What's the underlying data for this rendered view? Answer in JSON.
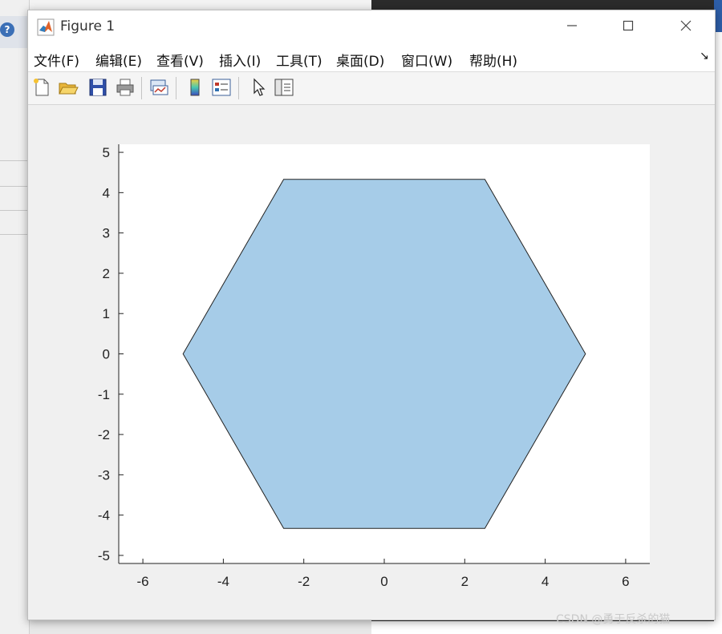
{
  "window": {
    "title": "Figure 1"
  },
  "menu": [
    {
      "label": "文件(F)"
    },
    {
      "label": "编辑(E)"
    },
    {
      "label": "查看(V)"
    },
    {
      "label": "插入(I)"
    },
    {
      "label": "工具(T)"
    },
    {
      "label": "桌面(D)"
    },
    {
      "label": "窗口(W)"
    },
    {
      "label": "帮助(H)"
    }
  ],
  "toolbar_icons": [
    "new-figure-icon",
    "open-file-icon",
    "save-icon",
    "print-icon",
    "link-plot-icon",
    "insert-colorbar-icon",
    "insert-legend-icon",
    "edit-plot-cursor-icon",
    "property-inspector-icon"
  ],
  "watermark": "CSDN @勇于反杀的猫",
  "colors": {
    "fill": "#a6cce8",
    "edge": "#222222",
    "axes_bg": "#ffffff"
  },
  "chart_data": {
    "type": "area",
    "title": "",
    "xlabel": "",
    "ylabel": "",
    "xlim": [
      -6.6,
      6.6
    ],
    "ylim": [
      -5.2,
      5.2
    ],
    "x_ticks": [
      -6,
      -4,
      -2,
      0,
      2,
      4,
      6
    ],
    "y_ticks": [
      5,
      4,
      3,
      2,
      1,
      0,
      -1,
      -2,
      -3,
      -4,
      -5
    ],
    "grid": false,
    "polygon": [
      {
        "x": 5,
        "y": 0
      },
      {
        "x": 2.5,
        "y": 4.33
      },
      {
        "x": -2.5,
        "y": 4.33
      },
      {
        "x": -5,
        "y": 0
      },
      {
        "x": -2.5,
        "y": -4.33
      },
      {
        "x": 2.5,
        "y": -4.33
      }
    ]
  }
}
